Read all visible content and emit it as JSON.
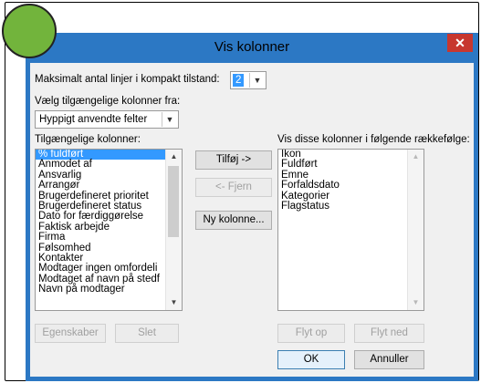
{
  "dialog": {
    "title": "Vis kolonner",
    "close_glyph": "✕"
  },
  "max_lines": {
    "label": "Maksimalt antal linjer i kompakt tilstand:",
    "value": "2"
  },
  "source": {
    "label": "Vælg tilgængelige kolonner fra:",
    "value": "Hyppigt anvendte felter"
  },
  "available": {
    "label": "Tilgængelige kolonner:",
    "items": [
      "% fuldført",
      "Anmodet af",
      "Ansvarlig",
      "Arrangør",
      "Brugerdefineret prioritet",
      "Brugerdefineret status",
      "Dato for færdiggørelse",
      "Faktisk arbejde",
      "Firma",
      "Følsomhed",
      "Kontakter",
      "Modtager ingen omfordeli",
      "Modtaget af navn på stedf",
      "Navn på modtager"
    ],
    "selected_index": 0
  },
  "shown": {
    "label": "Vis disse kolonner i følgende rækkefølge:",
    "items": [
      "Ikon",
      "Fuldført",
      "Emne",
      "Forfaldsdato",
      "Kategorier",
      "Flagstatus"
    ]
  },
  "buttons": {
    "add": "Tilføj ->",
    "remove": "<- Fjern",
    "new_column": "Ny kolonne...",
    "properties": "Egenskaber",
    "delete": "Slet",
    "move_up": "Flyt op",
    "move_down": "Flyt ned",
    "ok": "OK",
    "cancel": "Annuller"
  },
  "colors": {
    "title_bar": "#2c78c4",
    "close_button": "#c7372f",
    "selection": "#3399ff",
    "badge": "#72b43c"
  }
}
